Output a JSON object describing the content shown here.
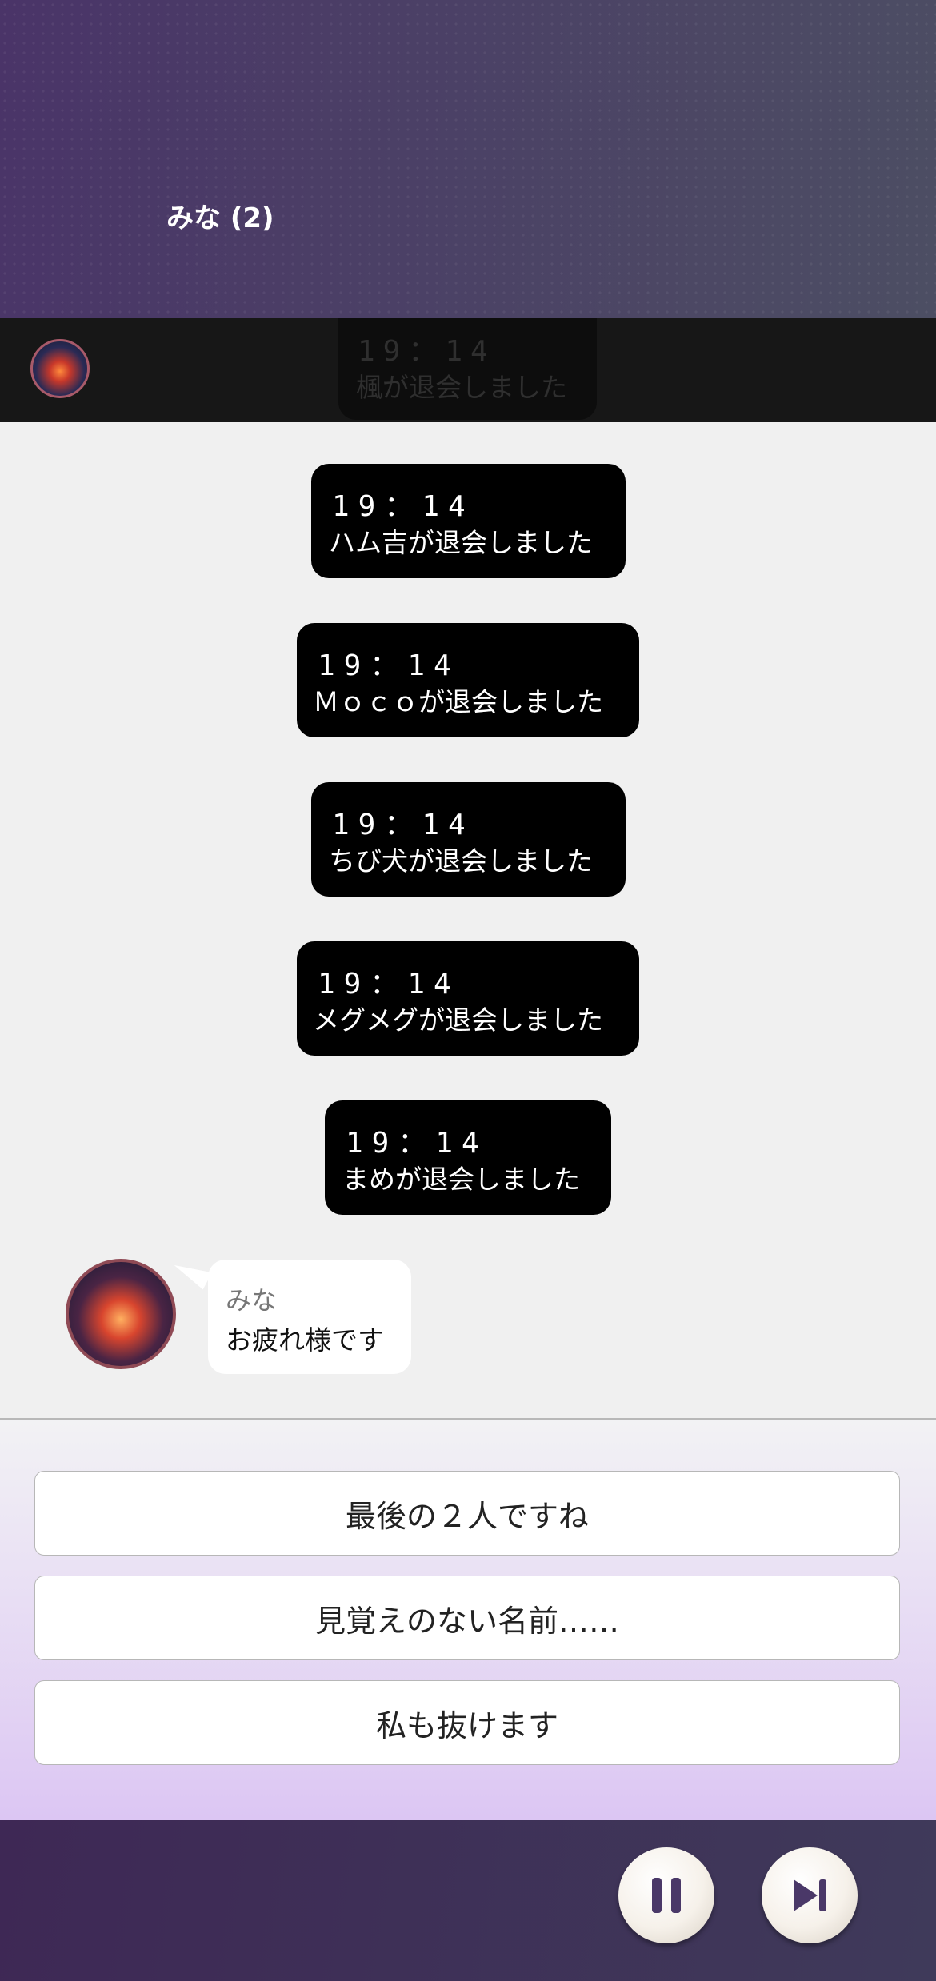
{
  "header": {
    "title": "みな (2)"
  },
  "ghost_message": {
    "time": "19：14",
    "text": "楓が退会しました"
  },
  "system_messages": [
    {
      "time": "19：14",
      "text": "ハム吉が退会しました"
    },
    {
      "time": "19：14",
      "text": "Ｍｏｃｏが退会しました"
    },
    {
      "time": "19：14",
      "text": "ちび犬が退会しました"
    },
    {
      "time": "19：14",
      "text": "メグメグが退会しました"
    },
    {
      "time": "19：14",
      "text": "まめが退会しました"
    }
  ],
  "chat_message": {
    "sender": "みな",
    "text": "お疲れ様です"
  },
  "choices": [
    {
      "label": "最後の２人ですね"
    },
    {
      "label": "見覚えのない名前……"
    },
    {
      "label": "私も抜けます"
    }
  ],
  "controls": {
    "pause_icon": "pause-icon",
    "skip_icon": "skip-forward-icon"
  },
  "colors": {
    "header": "#4a3468",
    "message_bg": "#000000",
    "choice_panel_bottom": "#dcc6f3",
    "footer": "#3e2855"
  }
}
